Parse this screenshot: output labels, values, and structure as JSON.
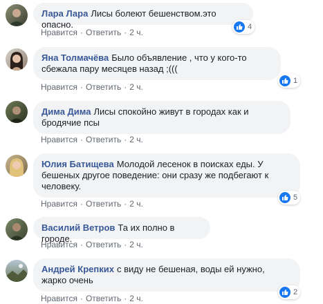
{
  "comments": [
    {
      "author": "Лара Лара",
      "text": "Лисы болеют бешенством.это опасно.",
      "like": "Нравится",
      "reply": "Ответить",
      "time": "2 ч.",
      "reactions": "4"
    },
    {
      "author": "Яна Толмачёва",
      "text": "Было объявление , что у кого-то сбежала пару месяцев назад ;(((",
      "like": "Нравится",
      "reply": "Ответить",
      "time": "2 ч.",
      "reactions": "1"
    },
    {
      "author": "Дима Дима",
      "text": "Лисы спокойно живут в городах как и бродячие псы",
      "like": "Нравится",
      "reply": "Ответить",
      "time": "2 ч.",
      "reactions": ""
    },
    {
      "author": "Юлия Батищева",
      "text": "Молодой лесенок в поисках еды. У бешеных другое поведение: они сразу же подбегают к человеку.",
      "like": "Нравится",
      "reply": "Ответить",
      "time": "2 ч.",
      "reactions": "5"
    },
    {
      "author": "Василий Ветров",
      "text": "Та их полно в городе.",
      "like": "Нравится",
      "reply": "Ответить",
      "time": "2 ч.",
      "reactions": ""
    },
    {
      "author": "Андрей Крепких",
      "text": "с виду не бешеная, воды ей нужно, жарко очень",
      "like": "Нравится",
      "reply": "Ответить",
      "time": "2 ч.",
      "reactions": "2"
    }
  ],
  "colors": {
    "author": "#385898",
    "bubble": "#f2f3f5",
    "like": "#1877f2"
  }
}
